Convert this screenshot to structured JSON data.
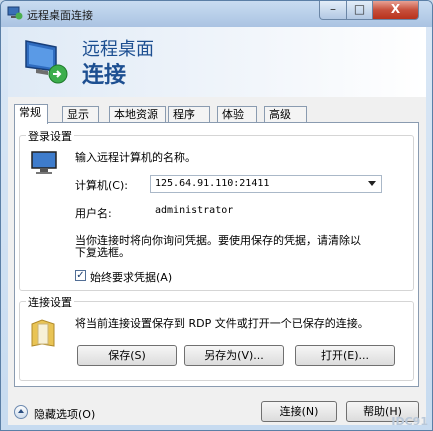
{
  "window": {
    "title": "远程桌面连接",
    "min": "–",
    "max": "□",
    "close": "X"
  },
  "header": {
    "line1": "远程桌面",
    "line2": "连接"
  },
  "tabs": [
    "常规",
    "显示",
    "本地资源",
    "程序",
    "体验",
    "高级"
  ],
  "login": {
    "group_title": "登录设置",
    "prompt": "输入远程计算机的名称。",
    "computer_label": "计算机(C):",
    "computer_value": "125.64.91.110:21411",
    "username_label": "用户名:",
    "username_value": "administrator",
    "info_line1": "当你连接时将向你询问凭据。要使用保存的凭据，请清除以",
    "info_line2": "下复选框。",
    "always_ask_checked": true,
    "always_ask_label": "始终要求凭据(A)"
  },
  "connection": {
    "group_title": "连接设置",
    "description": "将当前连接设置保存到 RDP 文件或打开一个已保存的连接。",
    "save": "保存(S)",
    "save_as": "另存为(V)...",
    "open": "打开(E)..."
  },
  "footer": {
    "hide_options": "隐藏选项(O)",
    "connect": "连接(N)",
    "help": "帮助(H)"
  },
  "watermark": "IDC91"
}
